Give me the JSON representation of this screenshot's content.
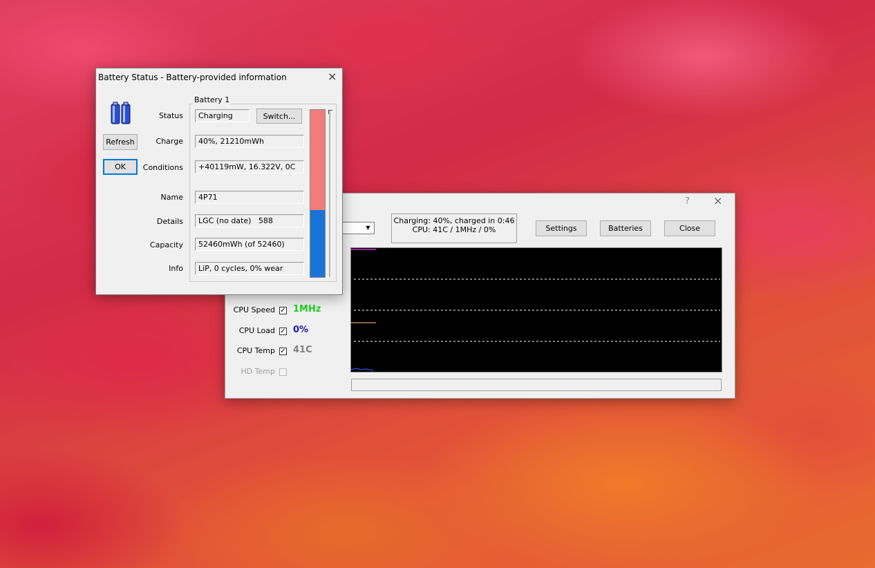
{
  "monitor": {
    "help_glyph": "?",
    "close_glyph": "×",
    "status_line1": "Charging: 40%, charged in 0:46",
    "status_line2": "CPU: 41C / 1MHz / 0%",
    "buttons": {
      "settings": "Settings",
      "batteries": "Batteries",
      "close": "Close"
    },
    "indicators": [
      {
        "label": "CPU Speed",
        "value": "1MHz",
        "checked": true,
        "color": "#22cc22"
      },
      {
        "label": "CPU Load",
        "value": "0%",
        "checked": true,
        "color": "#1a1aa6"
      },
      {
        "label": "CPU Temp",
        "value": "41C",
        "checked": true,
        "color": "#808080"
      },
      {
        "label": "HD Temp",
        "value": "",
        "checked": false,
        "disabled": true
      }
    ],
    "graph_colors": {
      "background": "#000000",
      "speed": "#cc33cc",
      "temp": "#c08060",
      "load": "#3344cc"
    }
  },
  "battery_dialog": {
    "title": "Battery Status - Battery-provided information",
    "close_glyph": "×",
    "refresh_label": "Refresh",
    "ok_label": "OK",
    "group_title": "Battery 1",
    "switch_label": "Switch...",
    "fields": {
      "status_label": "Status",
      "status_value": "Charging",
      "charge_label": "Charge",
      "charge_value": "40%, 21210mWh",
      "conditions_label": "Conditions",
      "conditions_value": "+40119mW, 16.322V, 0C",
      "name_label": "Name",
      "name_value": "4P71",
      "details_label": "Details",
      "details_value": "LGC (no date)   588",
      "capacity_label": "Capacity",
      "capacity_value": "52460mWh (of 52460)",
      "info_label": "Info",
      "info_value": "LiP, 0 cycles, 0% wear"
    },
    "charge_level": 0.4,
    "bar_colors": {
      "filled": "#1a74d8",
      "empty": "#f07c7c"
    }
  }
}
